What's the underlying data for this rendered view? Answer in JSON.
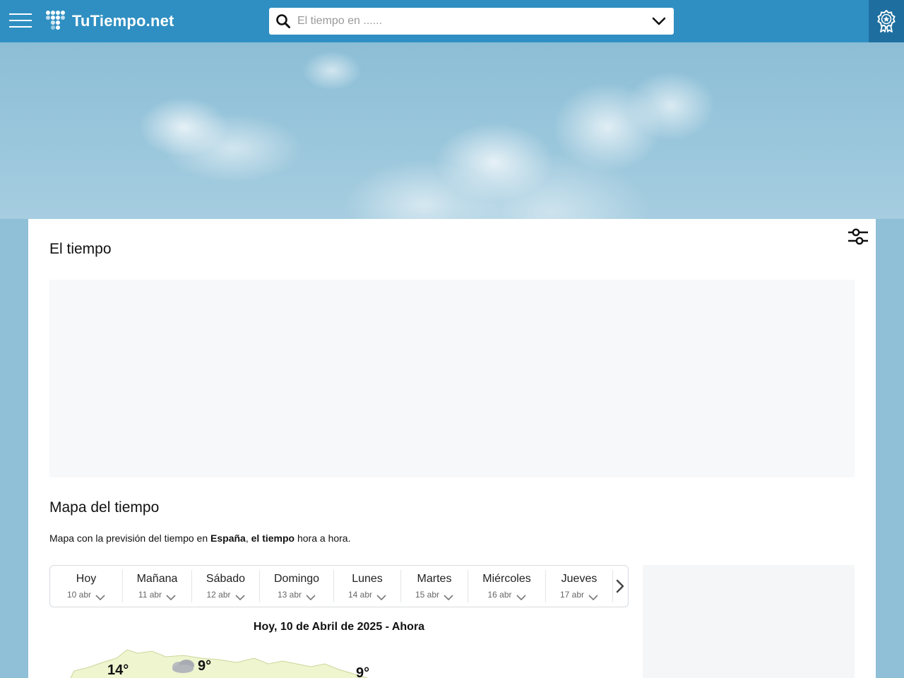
{
  "header": {
    "logo_text": "TuTiempo.net",
    "search_placeholder": "El tiempo en ......",
    "brand_color": "#2f8fc2"
  },
  "icons": [
    "menu-icon",
    "logo-dots-icon",
    "search-icon",
    "chevron-down-icon",
    "award-ribbon-icon",
    "settings-sliders-icon",
    "chevron-right-icon",
    "moon-icon",
    "cloud-icon"
  ],
  "main": {
    "title": "El tiempo",
    "map_heading": "Mapa del tiempo",
    "desc_pre": "Mapa con la previsión del tiempo en ",
    "desc_country": "España",
    "desc_sep": ", ",
    "desc_bold2": "el tiempo",
    "desc_post": " hora a hora.",
    "map_title": "Hoy, 10 de Abril de 2025 - Ahora"
  },
  "days": [
    {
      "name": "Hoy",
      "date": "10 abr"
    },
    {
      "name": "Mañana",
      "date": "11 abr"
    },
    {
      "name": "Sábado",
      "date": "12 abr"
    },
    {
      "name": "Domingo",
      "date": "13 abr"
    },
    {
      "name": "Lunes",
      "date": "14 abr"
    },
    {
      "name": "Martes",
      "date": "15 abr"
    },
    {
      "name": "Miércoles",
      "date": "16 abr"
    },
    {
      "name": "Jueves",
      "date": "17 abr"
    }
  ],
  "map_temps": [
    "14°",
    "9°",
    "9°"
  ]
}
